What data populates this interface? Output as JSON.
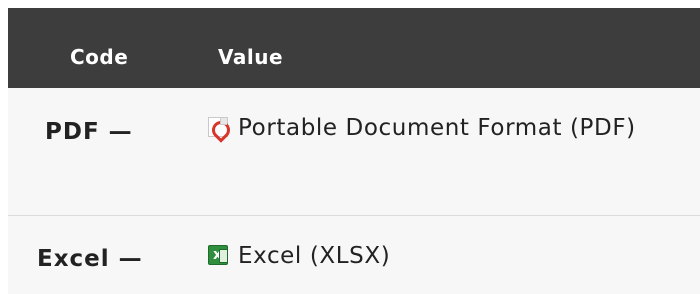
{
  "table": {
    "headers": {
      "code": "Code",
      "value": "Value"
    },
    "rows": [
      {
        "code": "PDF —",
        "icon": "pdf-file-icon",
        "value": "Portable Document Format (PDF)"
      },
      {
        "code": "Excel —",
        "icon": "excel-file-icon",
        "value": "Excel (XLSX)"
      }
    ]
  },
  "colors": {
    "header_background": "#3d3d3d",
    "header_text": "#ffffff",
    "row_background": "#f7f7f7",
    "row_divider": "#dcdcdc",
    "pdf_icon_accent": "#d8352b",
    "excel_icon_accent": "#2f8f3f"
  }
}
